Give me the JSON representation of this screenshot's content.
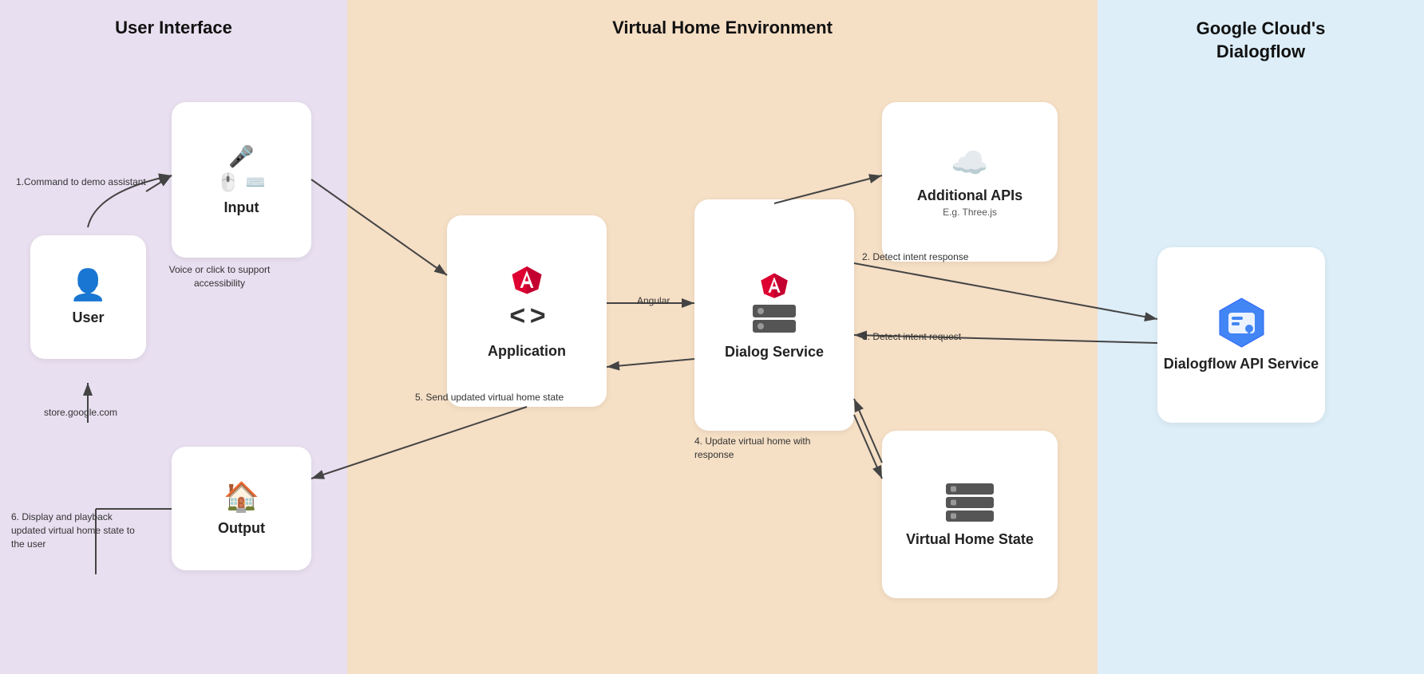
{
  "sections": {
    "ui": {
      "title": "User Interface",
      "bg": "#e8dff0"
    },
    "vhe": {
      "title": "Virtual Home Environment",
      "bg": "#f5dfc5"
    },
    "gcd": {
      "title": "Google Cloud's\nDialogflow",
      "bg": "#ddeef8"
    }
  },
  "boxes": {
    "user": {
      "label": "User"
    },
    "input": {
      "label": "Input"
    },
    "output": {
      "label": "Output"
    },
    "application": {
      "label": "Application"
    },
    "dialog_service": {
      "label": "Dialog\nService"
    },
    "additional_apis": {
      "label": "Additional\nAPIs",
      "sub": "E.g. Three.js"
    },
    "virtual_home_state": {
      "label": "Virtual\nHome State"
    },
    "dialogflow": {
      "label": "Dialogflow\nAPI Service"
    }
  },
  "labels": {
    "command": "1.Command to demo\nassistant",
    "voice": "Voice or click to\nsupport accessibility",
    "angular": "Angular",
    "send_state": "5. Send updated virtual\nhome state",
    "detect_response": "2. Detect intent response",
    "detect_request": "3. Detect intent request",
    "update_home": "4. Update virtual home\nwith response",
    "display": "6. Display and playback\nupdated virtual home\nstate to the user",
    "store": "store.google.com"
  }
}
